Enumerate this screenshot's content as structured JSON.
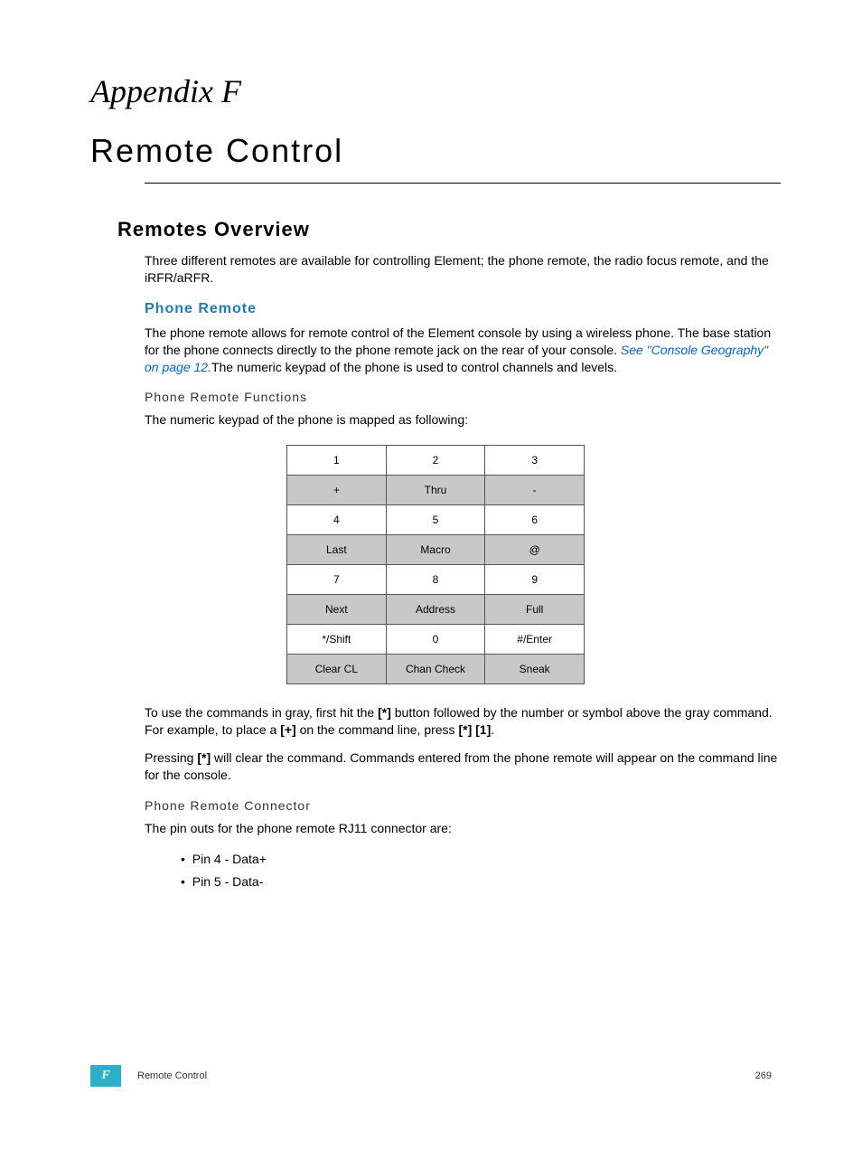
{
  "appendix_label": "Appendix F",
  "chapter_title": "Remote Control",
  "sections": {
    "overview_heading": "Remotes Overview",
    "overview_body": "Three different remotes are available for controlling Element; the phone remote, the radio focus remote, and the iRFR/aRFR.",
    "phone_remote_heading": "Phone Remote",
    "phone_remote_body_pre": "The phone remote allows for remote control of the Element console by using a wireless phone. The base station for the phone connects directly to the phone remote jack on the rear of your console. ",
    "phone_remote_link": "See \"Console Geography\" on page 12.",
    "phone_remote_body_post": "The numeric keypad of the phone is used to control channels and levels.",
    "functions_heading": "Phone Remote Functions",
    "functions_intro": "The numeric keypad of the phone is mapped as following:",
    "keypad_rows": [
      [
        {
          "t": "1",
          "g": false
        },
        {
          "t": "2",
          "g": false
        },
        {
          "t": "3",
          "g": false
        }
      ],
      [
        {
          "t": "+",
          "g": true
        },
        {
          "t": "Thru",
          "g": true
        },
        {
          "t": "-",
          "g": true
        }
      ],
      [
        {
          "t": "4",
          "g": false
        },
        {
          "t": "5",
          "g": false
        },
        {
          "t": "6",
          "g": false
        }
      ],
      [
        {
          "t": "Last",
          "g": true
        },
        {
          "t": "Macro",
          "g": true
        },
        {
          "t": "@",
          "g": true
        }
      ],
      [
        {
          "t": "7",
          "g": false
        },
        {
          "t": "8",
          "g": false
        },
        {
          "t": "9",
          "g": false
        }
      ],
      [
        {
          "t": "Next",
          "g": true
        },
        {
          "t": "Address",
          "g": true
        },
        {
          "t": "Full",
          "g": true
        }
      ],
      [
        {
          "t": "*/Shift",
          "g": false
        },
        {
          "t": "0",
          "g": false
        },
        {
          "t": "#/Enter",
          "g": false
        }
      ],
      [
        {
          "t": "Clear CL",
          "g": true
        },
        {
          "t": "Chan Check",
          "g": true
        },
        {
          "t": "Sneak",
          "g": true
        }
      ]
    ],
    "usage_para": {
      "pre1": "To use the commands in gray, first hit the ",
      "b1": "[*]",
      "mid1": " button followed by the number or symbol above the gray command. For example, to place a ",
      "b2": "[+]",
      "mid2": " on the command line, press ",
      "b3": "[*] [1]",
      "post": "."
    },
    "clear_para": {
      "pre": "Pressing ",
      "b1": "[*]",
      "post": " will clear the command. Commands entered from the phone remote will appear on the command line for the console."
    },
    "connector_heading": "Phone Remote Connector",
    "connector_intro": "The pin outs for the phone remote RJ11 connector are:",
    "pins": [
      "Pin 4 - Data+",
      "Pin 5 - Data-"
    ]
  },
  "footer": {
    "badge": "F",
    "section": "Remote Control",
    "page": "269"
  }
}
